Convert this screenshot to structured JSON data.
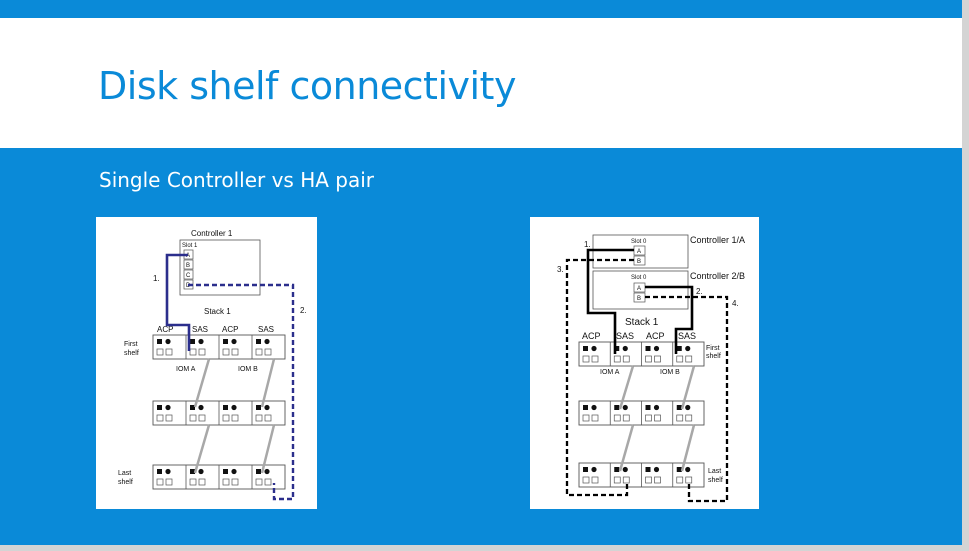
{
  "slide": {
    "title": "Disk shelf connectivity",
    "subtitle": "Single Controller vs HA pair"
  },
  "left_diagram": {
    "controller_label": "Controller 1",
    "slot_label": "Slot 1",
    "ports": [
      "A",
      "B",
      "C",
      "D"
    ],
    "stack_label": "Stack 1",
    "module_labels": [
      "ACP",
      "SAS",
      "ACP",
      "SAS"
    ],
    "first_shelf_label": [
      "First",
      "shelf"
    ],
    "last_shelf_label": [
      "Last",
      "shelf"
    ],
    "iom_labels": [
      "IOM A",
      "IOM B"
    ],
    "step_labels": [
      "1.",
      "2."
    ],
    "colors": {
      "cable_1": "#2b2e8c",
      "cable_2": "#2b2e8c",
      "daisy": "#a8a8a8"
    }
  },
  "right_diagram": {
    "controller_top_label": "Controller 1/A",
    "controller_bottom_label": "Controller 2/B",
    "slot_label": "Slot 0",
    "ports": [
      "A",
      "B"
    ],
    "stack_label": "Stack 1",
    "module_labels": [
      "ACP",
      "SAS",
      "ACP",
      "SAS"
    ],
    "first_shelf_label": [
      "First",
      "shelf"
    ],
    "last_shelf_label": [
      "Last",
      "shelf"
    ],
    "iom_labels": [
      "IOM A",
      "IOM B"
    ],
    "step_labels": [
      "1.",
      "2.",
      "3.",
      "4."
    ],
    "colors": {
      "cable": "#000000",
      "daisy": "#a8a8a8"
    }
  }
}
